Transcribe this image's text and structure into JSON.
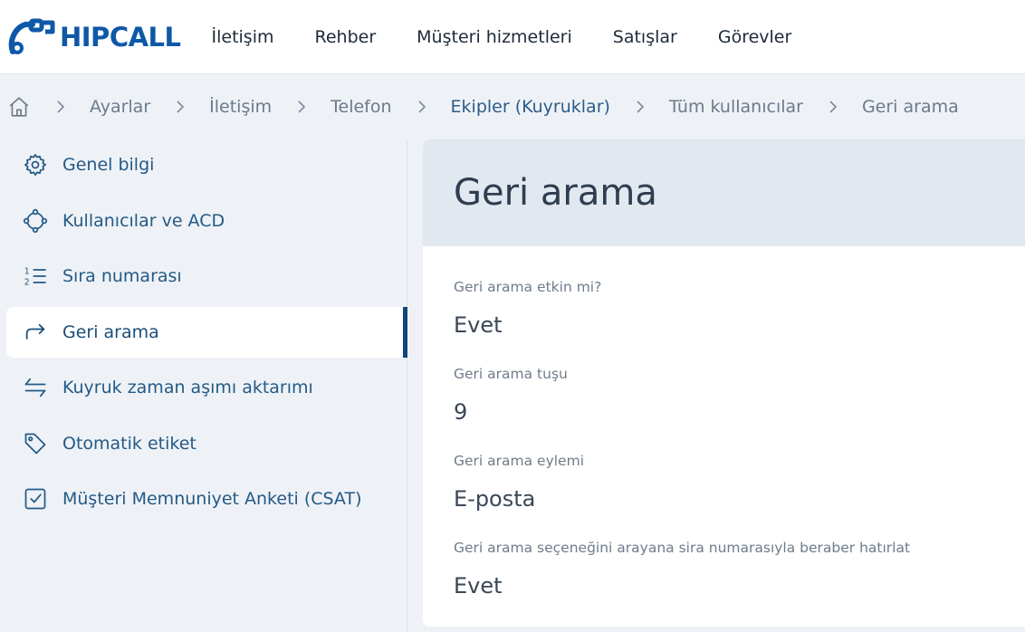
{
  "app": {
    "logo_text": "HIPCALL"
  },
  "nav": {
    "items": [
      "İletişim",
      "Rehber",
      "Müşteri hizmetleri",
      "Satışlar",
      "Görevler"
    ]
  },
  "breadcrumb": {
    "items": [
      "Ayarlar",
      "İletişim",
      "Telefon",
      "Ekipler (Kuyruklar)",
      "Tüm kullanıcılar",
      "Geri arama"
    ]
  },
  "sidebar": {
    "items": [
      {
        "label": "Genel bilgi",
        "icon": "gear-icon"
      },
      {
        "label": "Kullanıcılar ve ACD",
        "icon": "users-cycle-icon"
      },
      {
        "label": "Sıra numarası",
        "icon": "numbered-list-icon"
      },
      {
        "label": "Geri arama",
        "icon": "forward-arrow-icon",
        "active": true
      },
      {
        "label": "Kuyruk zaman aşımı aktarımı",
        "icon": "transfer-arrows-icon"
      },
      {
        "label": "Otomatik etiket",
        "icon": "tag-icon"
      },
      {
        "label": "Müşteri Memnuniyet Anketi (CSAT)",
        "icon": "checkbox-icon"
      }
    ]
  },
  "main": {
    "title": "Geri arama",
    "fields": [
      {
        "label": "Geri arama etkin mi?",
        "value": "Evet"
      },
      {
        "label": "Geri arama tuşu",
        "value": "9"
      },
      {
        "label": "Geri arama eylemi",
        "value": "E-posta"
      },
      {
        "label": "Geri arama seçeneğini arayana sira numarasıyla beraber hatırlat",
        "value": "Evet"
      }
    ]
  },
  "colors": {
    "brand": "#0e58a8",
    "sidebar_text": "#245a85",
    "active_indicator": "#0e4778",
    "background": "#eef2f7",
    "header_band": "#e1e8f0"
  }
}
